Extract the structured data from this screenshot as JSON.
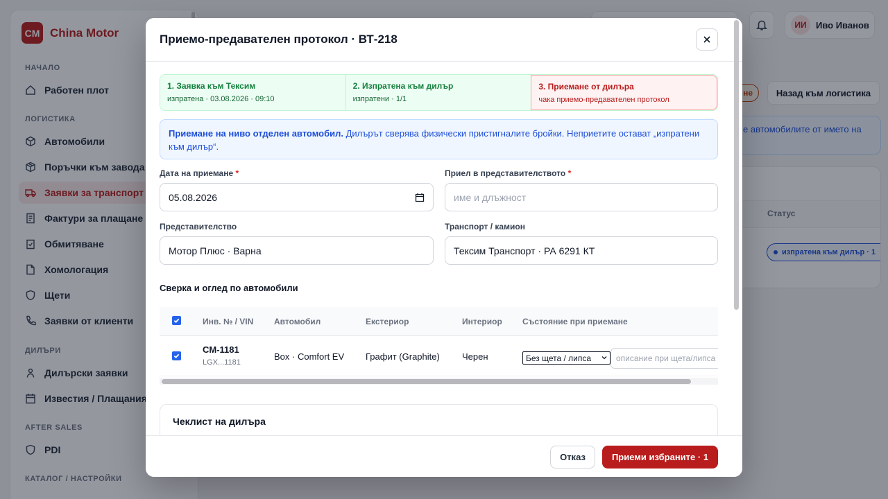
{
  "brand": {
    "logo": "CM",
    "name": "China Motor"
  },
  "sidebar": {
    "sections": [
      {
        "label": "НАЧАЛО",
        "items": [
          {
            "label": "Работен плот",
            "icon": "home-icon"
          }
        ]
      },
      {
        "label": "ЛОГИСТИКА",
        "items": [
          {
            "label": "Автомобили",
            "icon": "cube-icon"
          },
          {
            "label": "Поръчки към завода",
            "icon": "box-icon"
          },
          {
            "label": "Заявки за транспорт",
            "icon": "truck-icon",
            "active": true
          },
          {
            "label": "Фактури за плащане",
            "icon": "receipt-icon"
          },
          {
            "label": "Обмитяване",
            "icon": "clipboard-check-icon"
          },
          {
            "label": "Хомологация",
            "icon": "file-icon"
          },
          {
            "label": "Щети",
            "icon": "shield-icon"
          },
          {
            "label": "Заявки от клиенти",
            "icon": "phone-icon"
          }
        ]
      },
      {
        "label": "ДИЛЪРИ",
        "items": [
          {
            "label": "Дилърски заявки",
            "icon": "user-icon"
          },
          {
            "label": "Известия / Плащания",
            "icon": "calendar-icon"
          }
        ]
      },
      {
        "label": "AFTER SALES",
        "items": [
          {
            "label": "PDI",
            "icon": "shield-icon"
          }
        ]
      },
      {
        "label": "КАТАЛОГ / НАСТРОЙКИ",
        "items": []
      }
    ]
  },
  "topbar": {
    "user_initials": "ИИ",
    "user_name": "Иво Иванов"
  },
  "background": {
    "badge": "не",
    "back_button": "Назад към логистика",
    "info_text": "е автомобилите от името на",
    "status_column": "Статус",
    "status_pill": "изпратена към дилър · 1"
  },
  "modal": {
    "title": "Приемо-предавателен протокол · ВТ-218",
    "steps": [
      {
        "title": "1. Заявка към Тексим",
        "sub": "изпратена · 03.08.2026 · 09:10",
        "state": "done"
      },
      {
        "title": "2. Изпратена към дилър",
        "sub": "изпратени · 1/1",
        "state": "done"
      },
      {
        "title": "3. Приемане от дилъра",
        "sub": "чака приемо-предавателен протокол",
        "state": "pending"
      }
    ],
    "info_bold": "Приемане на ниво отделен автомобил.",
    "info_text": " Дилърът сверява физически пристигналите бройки. Неприетите остават „изпратени към дилър“.",
    "form": {
      "date_label": "Дата на приемане",
      "date_value": "05.08.2026",
      "received_label": "Приел в представителството",
      "received_placeholder": "име и длъжност",
      "dealer_label": "Представителство",
      "dealer_value": "Мотор Плюс · Варна",
      "transport_label": "Транспорт / камион",
      "transport_value": "Тексим Транспорт · РА 6291 КТ",
      "required_mark": "*"
    },
    "section_title": "Сверка и оглед по автомобили",
    "table": {
      "columns": [
        "Инв. № / VIN",
        "Автомобил",
        "Екстериор",
        "Интериор",
        "Състояние при приемане"
      ],
      "rows": [
        {
          "inv": "CM-1181",
          "vin": "LGX...1181",
          "car": "Box · Comfort EV",
          "exterior": "Графит (Graphite)",
          "interior": "Черен",
          "condition": "Без щета / липса",
          "damage_placeholder": "описание при щета/липса",
          "checked": true
        }
      ]
    },
    "checklist_title": "Чеклист на дилъра",
    "footer": {
      "cancel": "Отказ",
      "accept": "Приеми избраните · 1"
    }
  },
  "colors": {
    "brand": "#b91c1c",
    "success": "#15803d",
    "info": "#1d4ed8",
    "danger": "#b91c1c"
  }
}
